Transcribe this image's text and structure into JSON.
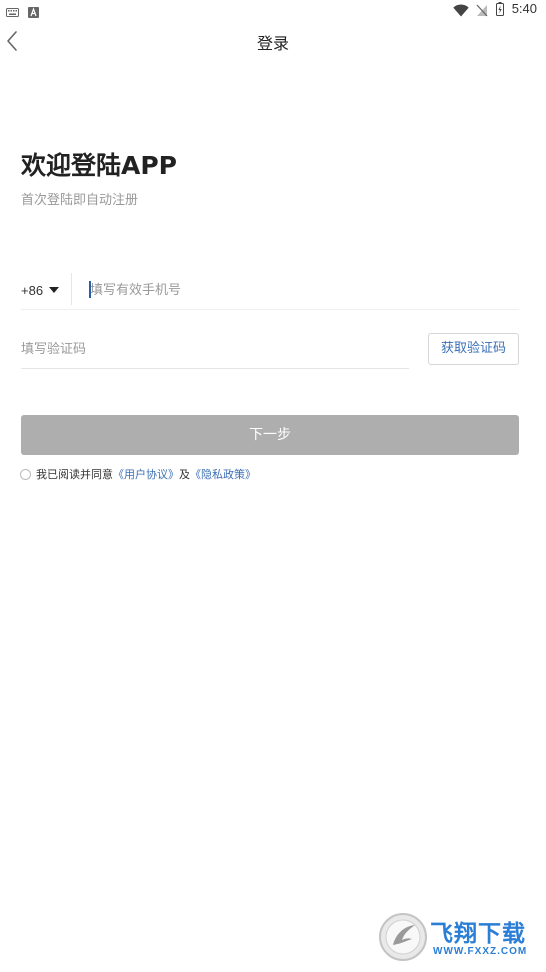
{
  "status_bar": {
    "time": "5:40",
    "icons": [
      "keyboard-icon",
      "a-notification-icon",
      "wifi-icon",
      "no-sim-icon",
      "battery-icon"
    ]
  },
  "nav": {
    "title": "登录",
    "back_icon": "chevron-left-icon"
  },
  "welcome": {
    "title": "欢迎登陆APP",
    "subtitle": "首次登陆即自动注册"
  },
  "phone": {
    "country_code": "+86",
    "placeholder": "填写有效手机号",
    "value": ""
  },
  "verification": {
    "placeholder": "填写验证码",
    "value": "",
    "get_code_label": "获取验证码"
  },
  "next_button_label": "下一步",
  "agreement": {
    "checked": false,
    "prefix": "我已阅读并同意",
    "user_agreement": "《用户协议》",
    "connector": "及",
    "privacy_policy": "《隐私政策》"
  },
  "watermark": {
    "title": "飞翔下载",
    "url": "WWW.FXXZ.COM"
  },
  "colors": {
    "accent": "#3b6fb5",
    "button_disabled": "#aeaeae",
    "placeholder": "#999999",
    "watermark": "#2b7ed6"
  }
}
